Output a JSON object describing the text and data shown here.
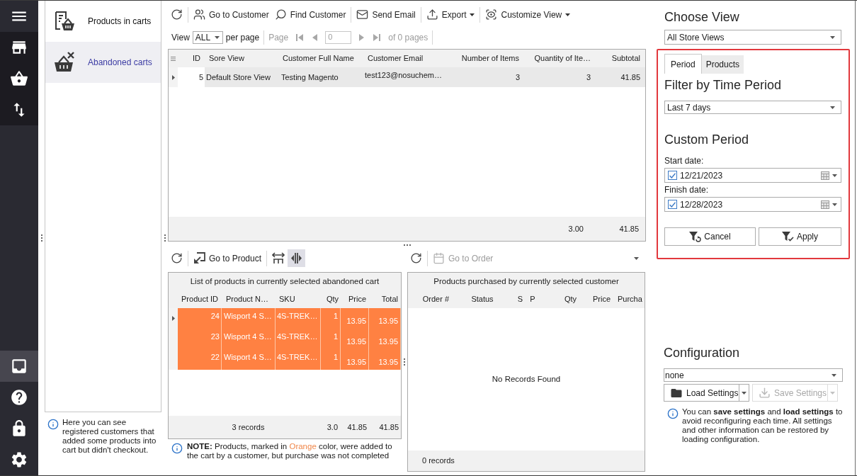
{
  "rail": {
    "top": [
      {
        "kind": "menu",
        "selected": false
      },
      {
        "kind": "store",
        "selected": false
      },
      {
        "kind": "basket",
        "selected": false
      },
      {
        "kind": "transfer",
        "selected": false
      }
    ],
    "bottom": [
      {
        "kind": "archive",
        "selected": true
      },
      {
        "kind": "help",
        "selected": false
      },
      {
        "kind": "lock",
        "selected": false
      },
      {
        "kind": "settings",
        "selected": false
      }
    ]
  },
  "navigation": {
    "items": [
      {
        "kind": "cart_products",
        "label": "Products in carts",
        "selected": false
      },
      {
        "kind": "abandoned_carts",
        "label": "Abandoned carts",
        "selected": true
      }
    ],
    "info": "Here you can see registered customers that added some products into cart but didn't checkout."
  },
  "toolbar": {
    "groups": [
      {
        "items": [
          {
            "kind": "refresh",
            "dropdown": false
          }
        ]
      },
      {
        "items": [
          {
            "kind": "customer",
            "label": "Go to Customer",
            "dropdown": false
          },
          {
            "kind": "find",
            "label": "Find Customer",
            "dropdown": false
          }
        ]
      },
      {
        "items": [
          {
            "kind": "email",
            "label": "Send Email",
            "dropdown": false
          }
        ]
      },
      {
        "items": [
          {
            "kind": "export",
            "label": "Export",
            "dropdown": true
          }
        ]
      },
      {
        "items": [
          {
            "kind": "customize",
            "label": "Customize View",
            "dropdown": true
          }
        ]
      }
    ]
  },
  "pager": {
    "view_label": "View",
    "per_page": "ALL",
    "per_page_label": "per page",
    "page_label": "Page",
    "page": "0",
    "page_count": "of 0 pages",
    "disabled": true
  },
  "customers_grid": {
    "columns": [
      "ID",
      "Sore View",
      "Customer Full Name",
      "Customer Email",
      "Number of Items",
      "Quantity of Ite…",
      "Subtotal"
    ],
    "rows": [
      {
        "selected": true,
        "cells": [
          "5",
          "Default Store View",
          "Testing Magento",
          "test123@nosuchem…",
          "3",
          "3",
          "41.85"
        ]
      }
    ],
    "totals": {
      "quantity_of_items": "3.00",
      "subtotal": "41.85"
    }
  },
  "cart_products": {
    "toolbar": {
      "groups": [
        {
          "items": [
            {
              "kind": "refresh",
              "pressed": false
            }
          ]
        },
        {
          "items": [
            {
              "kind": "product",
              "label": "Go to Product",
              "pressed": false
            }
          ]
        },
        {
          "items": [
            {
              "kind": "fit_columns",
              "pressed": false
            },
            {
              "kind": "split_columns",
              "pressed": true
            }
          ]
        }
      ]
    },
    "title": "List of products in currently selected abandoned cart",
    "columns": [
      "Product ID",
      "Product N…",
      "SKU",
      "Qty",
      "Price",
      "Total"
    ],
    "rows": [
      {
        "selected": true,
        "marked": true,
        "cells": [
          "24",
          "Wisport 4 S…",
          "4S-TREK…",
          "1",
          "13.95",
          "13.95"
        ]
      },
      {
        "selected": false,
        "marked": true,
        "cells": [
          "23",
          "Wisport 4 S…",
          "4S-TREK…",
          "1",
          "13.95",
          "13.95"
        ]
      },
      {
        "selected": false,
        "marked": true,
        "cells": [
          "22",
          "Wisport 4 S…",
          "4S-TREK…",
          "1",
          "13.95",
          "13.95"
        ]
      }
    ],
    "footer": {
      "records": "3 records",
      "qty": "3.0",
      "price": "41.85",
      "total": "41.85"
    },
    "note": {
      "parts": [
        {
          "kind": "bold",
          "text": "NOTE:"
        },
        {
          "kind": "plain",
          "text": " Products, marked in "
        },
        {
          "kind": "accent",
          "text": "Orange",
          "color": "#f0874a"
        },
        {
          "kind": "plain",
          "text": " color, were added to the cart by a customer, but purchase was not completed"
        }
      ]
    }
  },
  "purchases": {
    "toolbar": {
      "groups": [
        {
          "items": [
            {
              "kind": "refresh",
              "disabled": false
            }
          ]
        },
        {
          "items": [
            {
              "kind": "order",
              "label": "Go to Order",
              "disabled": true
            }
          ]
        }
      ]
    },
    "title": "Products purchased by currently selected customer",
    "columns": [
      "Order #",
      "Status",
      "S",
      "P",
      "Qty",
      "Price",
      "Purcha"
    ],
    "empty_text": "No Records Found",
    "footer": "0 records"
  },
  "view_panel": {
    "title": "Choose View",
    "store_view": "All Store Views",
    "filter": {
      "highlighted": true,
      "tabs": [
        {
          "label": "Period",
          "selected": true
        },
        {
          "label": "Products",
          "selected": false
        }
      ],
      "title": "Filter by Time Period",
      "period": "Last 7 days",
      "custom_title": "Custom Period",
      "dates": [
        {
          "label": "Start date:",
          "value": "12/21/2023",
          "checked": true
        },
        {
          "label": "Finish date:",
          "value": "12/28/2023",
          "checked": true
        }
      ],
      "buttons": [
        {
          "kind": "cancel",
          "label": "Cancel"
        },
        {
          "kind": "apply",
          "label": "Apply"
        }
      ]
    }
  },
  "configuration": {
    "title": "Configuration",
    "value": "none",
    "buttons": [
      {
        "kind": "load",
        "label": "Load Settings",
        "disabled": false
      },
      {
        "kind": "save",
        "label": "Save Settings",
        "disabled": true
      }
    ],
    "info": "You can **save settings** and **load settings** to avoid reconfiguring each time. All settings and other information can be restored by loading configuration."
  }
}
